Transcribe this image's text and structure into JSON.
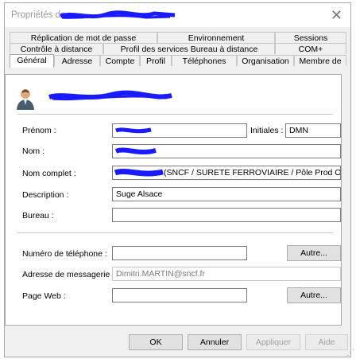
{
  "window": {
    "title": "Propriétés de :",
    "close_glyph": "✕"
  },
  "tabs": {
    "row1": [
      "Réplication de mot de passe",
      "Environnement",
      "Sessions"
    ],
    "row2": [
      "Contrôle à distance",
      "Profil des services Bureau à distance",
      "COM+"
    ],
    "row3": [
      "Général",
      "Adresse",
      "Compte",
      "Profil",
      "Téléphones",
      "Organisation",
      "Membre de"
    ],
    "active": "Général"
  },
  "general": {
    "prenom_label": "Prénom :",
    "prenom_value": "",
    "initiales_label": "Initiales :",
    "initiales_value": "DMN",
    "nom_label": "Nom :",
    "nom_value": "",
    "nom_complet_label": "Nom complet :",
    "nom_complet_value": "(SNCF / SURETE FERROVIAIRE / Pôle Prod Op",
    "description_label": "Description :",
    "description_value": "Suge Alsace",
    "bureau_label": "Bureau :",
    "bureau_value": "",
    "telephone_label": "Numéro de téléphone :",
    "telephone_value": "",
    "telephone_autre": "Autre...",
    "email_label": "Adresse de messagerie :",
    "email_value": "Dimitri.MARTIN@sncf.fr",
    "web_label": "Page Web :",
    "web_value": "",
    "web_autre": "Autre..."
  },
  "footer": {
    "ok": "OK",
    "annuler": "Annuler",
    "appliquer": "Appliquer",
    "aide": "Aide"
  },
  "colors": {
    "redaction": "#1a1aff",
    "window_bg": "#f0f0f0",
    "panel_bg": "#ffffff"
  }
}
